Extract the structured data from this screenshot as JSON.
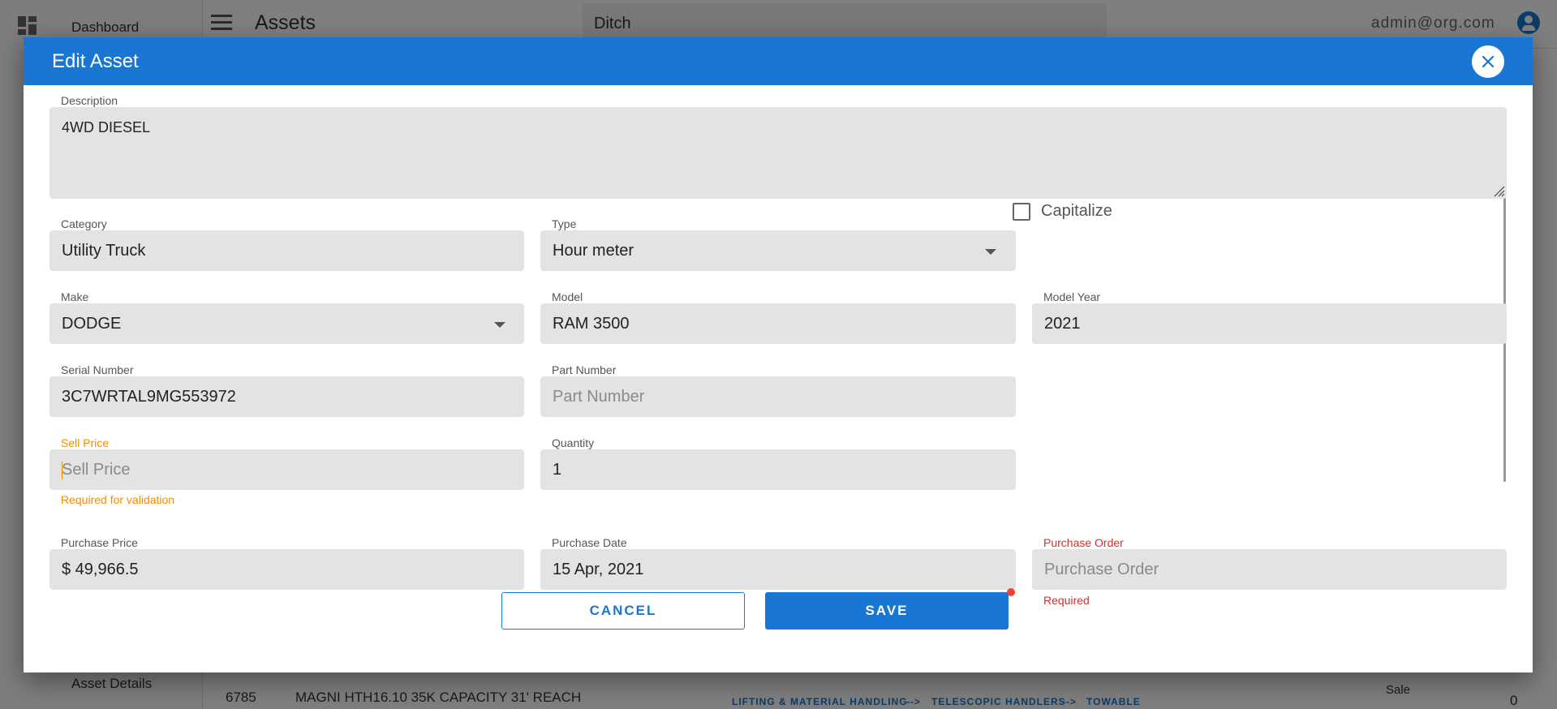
{
  "app": {
    "sidebar": {
      "dashboard_label": "Dashboard",
      "asset_details_label": "Asset Details"
    },
    "header": {
      "title": "Assets",
      "search_value": "Ditch",
      "user_email": "admin@org.com"
    },
    "background_table": {
      "row_id": "6785",
      "row_description": "MAGNI HTH16.10 35K CAPACITY 31' REACH",
      "category_path": [
        "LIFTING & MATERIAL HANDLING",
        "-->",
        "TELESCOPIC HANDLERS",
        "-->",
        "TOWABLE"
      ],
      "status_label": "Sale",
      "count": "0"
    }
  },
  "dialog": {
    "title": "Edit Asset",
    "close_icon": "close-icon",
    "fields": {
      "description": {
        "label": "Description",
        "value": "4WD DIESEL"
      },
      "category": {
        "label": "Category",
        "value": "Utility Truck"
      },
      "type": {
        "label": "Type",
        "value": "Hour meter"
      },
      "capitalize": {
        "label": "Capitalize",
        "checked": false
      },
      "make": {
        "label": "Make",
        "value": "DODGE"
      },
      "model": {
        "label": "Model",
        "value": "RAM 3500"
      },
      "model_year": {
        "label": "Model Year",
        "value": "2021"
      },
      "serial_number": {
        "label": "Serial Number",
        "value": "3C7WRTAL9MG553972"
      },
      "part_number": {
        "label": "Part Number",
        "placeholder": "Part Number"
      },
      "sell_price": {
        "label": "Sell Price",
        "placeholder": "Sell Price",
        "helper": "Required for validation"
      },
      "quantity": {
        "label": "Quantity",
        "value": "1"
      },
      "purchase_price": {
        "label": "Purchase Price",
        "value": "$ 49,966.5"
      },
      "purchase_date": {
        "label": "Purchase Date",
        "value": "15 Apr, 2021"
      },
      "purchase_order": {
        "label": "Purchase Order",
        "placeholder": "Purchase Order",
        "helper": "Required"
      }
    },
    "buttons": {
      "cancel": "CANCEL",
      "save": "SAVE"
    }
  },
  "colors": {
    "primary": "#1976d2",
    "warning": "#f08c00",
    "error": "#d32f2f",
    "field_bg": "#e3e3e3"
  }
}
